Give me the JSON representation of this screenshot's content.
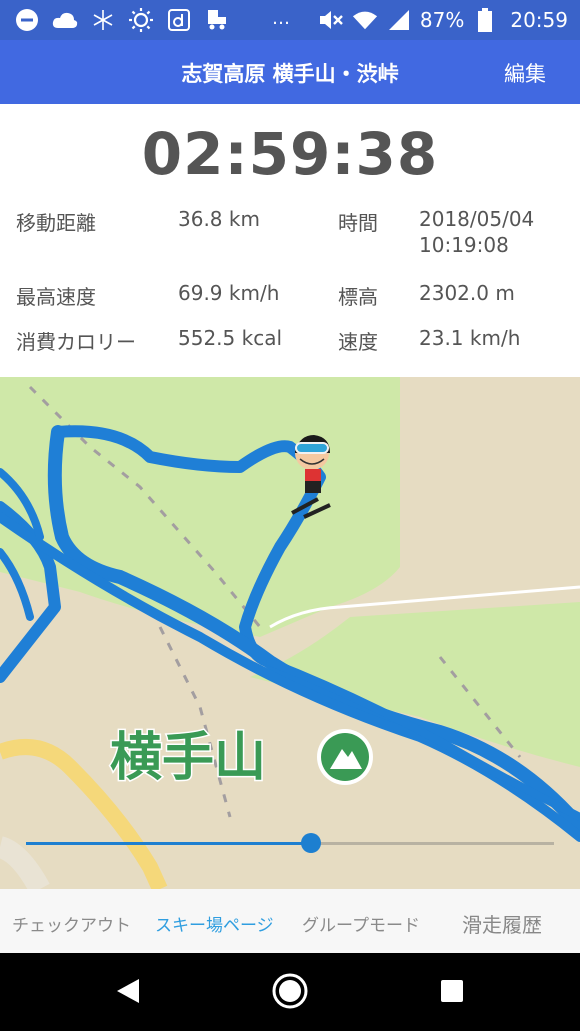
{
  "status_bar": {
    "battery_percent": "87%",
    "time": "20:59",
    "overflow": "…"
  },
  "app_bar": {
    "title": "志賀高原 横手山・渋峠",
    "edit_label": "編集"
  },
  "session": {
    "elapsed": "02:59:38",
    "stats": [
      {
        "label": "移動距離",
        "value": "36.8 km"
      },
      {
        "label": "時間",
        "value": "2018/05/04"
      },
      {
        "label": "",
        "value": "10:19:08"
      },
      {
        "label": "最高速度",
        "value": "69.9 km/h"
      },
      {
        "label": "標高",
        "value": "2302.0 m"
      },
      {
        "label": "消費カロリー",
        "value": "552.5 kcal"
      },
      {
        "label": "速度",
        "value": "23.1 km/h"
      }
    ]
  },
  "map": {
    "place_label": "横手山",
    "playback_progress": 0.54,
    "colors": {
      "land": "#e6dcc2",
      "park": "#cfe8a8",
      "track": "#1f7fd6",
      "road": "#f5d87a",
      "place_text": "#3a9a55"
    }
  },
  "tabs": [
    {
      "label": "チェックアウト",
      "active": false
    },
    {
      "label": "スキー場ページ",
      "active": true
    },
    {
      "label": "グループモード",
      "active": false
    },
    {
      "label": "滑走履歴",
      "active": false
    }
  ],
  "icons": [
    "dnd-icon",
    "cloud-icon",
    "snowflake-icon",
    "sun-icon",
    "d-app-icon",
    "truck-icon",
    "mute-icon",
    "wifi-icon",
    "signal-icon",
    "battery-icon",
    "mountain-icon",
    "skier-avatar-icon",
    "back-icon",
    "home-icon",
    "recents-icon"
  ]
}
